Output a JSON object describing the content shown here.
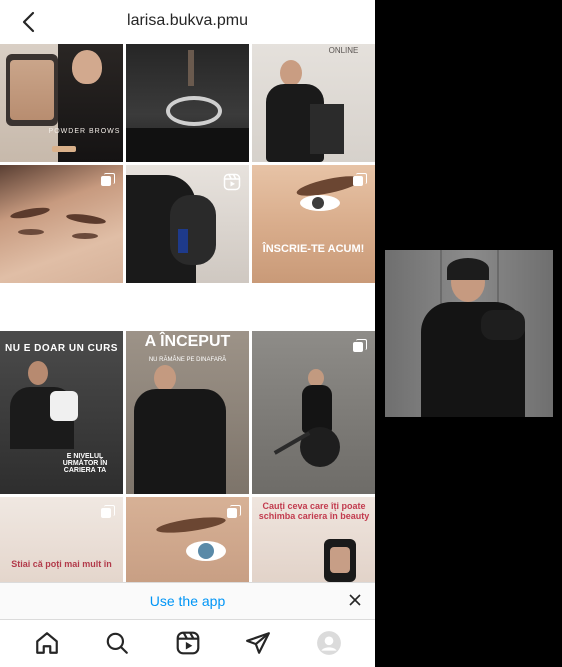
{
  "header": {
    "username": "larisa.bukva.pmu",
    "back_icon": "chevron-left-icon"
  },
  "posts": [
    {
      "overlay": "POWDER BROWS",
      "badge": "",
      "kind": "post"
    },
    {
      "overlay": "",
      "badge": "",
      "kind": "post"
    },
    {
      "overlay": "ONLINE",
      "badge": "",
      "kind": "post"
    },
    {
      "overlay": "",
      "badge": "carousel-icon",
      "kind": "carousel"
    },
    {
      "overlay": "",
      "badge": "reels-icon",
      "kind": "reel"
    },
    {
      "overlay": "ÎNSCRIE-TE ACUM!",
      "badge": "carousel-icon",
      "kind": "carousel"
    },
    {
      "overlay": "NU E DOAR UN CURS",
      "overlay2": "E NIVELUL URMĂTOR ÎN CARIERA TA",
      "badge": "",
      "kind": "post"
    },
    {
      "overlay": "A ÎNCEPUT",
      "overlay2": "NU RĂMÂNE PE DINAFARĂ",
      "badge": "",
      "kind": "post"
    },
    {
      "overlay": "",
      "badge": "carousel-icon",
      "kind": "carousel"
    },
    {
      "overlay": "Stiai că poți mai mult în",
      "badge": "carousel-icon",
      "kind": "carousel"
    },
    {
      "overlay": "",
      "badge": "carousel-icon",
      "kind": "carousel"
    },
    {
      "overlay": "Cauți ceva care îți poate schimba cariera în beauty",
      "badge": "",
      "kind": "post"
    }
  ],
  "banner": {
    "label": "Use the app"
  },
  "nav": {
    "items": [
      "home-icon",
      "search-icon",
      "reels-icon",
      "direct-icon",
      "profile-avatar"
    ]
  },
  "colors": {
    "link": "#0095f6",
    "border": "#dbdbdb",
    "text": "#262626"
  }
}
